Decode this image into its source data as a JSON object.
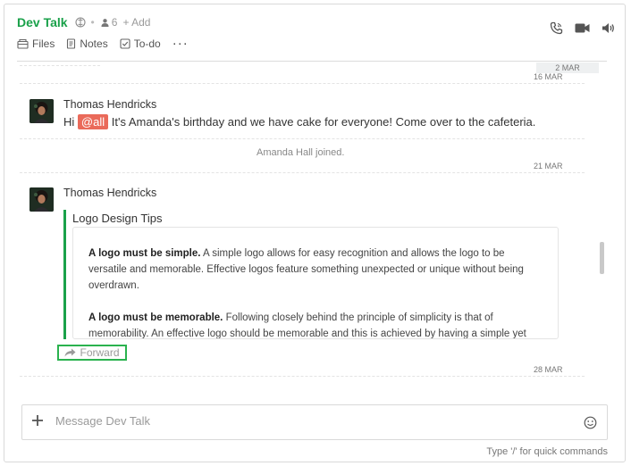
{
  "header": {
    "channel_title": "Dev Talk",
    "member_count": "6",
    "add_label": "+ Add",
    "tabs": [
      {
        "label": "Files",
        "icon": "files-icon"
      },
      {
        "label": "Notes",
        "icon": "notes-icon"
      },
      {
        "label": "To-do",
        "icon": "todo-icon"
      }
    ],
    "more_label": "···",
    "actions": [
      "phone-icon",
      "video-icon",
      "speaker-icon"
    ]
  },
  "timeline": {
    "top_badge": "2 MAR",
    "date_1": "16 MAR",
    "message_1": {
      "sender": "Thomas Hendricks",
      "prefix": "Hi",
      "mention": "@all",
      "text": "It's Amanda's birthday and we have cake for everyone! Come over to the cafeteria."
    },
    "system_message": "Amanda Hall joined.",
    "date_2": "21 MAR",
    "message_2": {
      "sender": "Thomas Hendricks",
      "card_title": "Logo Design Tips",
      "p1_bold": "A logo must be simple.",
      "p1_line1": "A simple logo allows for easy recognition and allows the logo to be",
      "p1_line2": "versatile and memorable. Effective logos feature something unexpected or unique without being",
      "p1_line3": "overdrawn.",
      "p2_bold": "A logo must be memorable.",
      "p2_line1": "Following closely behind the principle of simplicity is that of",
      "p2_line2": "memorability. An effective logo should be memorable and this is achieved by having a simple yet",
      "forward_label": "Forward"
    },
    "date_3": "28 MAR"
  },
  "composer": {
    "placeholder": "Message Dev Talk",
    "hint": "Type '/' for quick commands"
  },
  "colors": {
    "brand": "#1aa14a",
    "mention": "#ea6a5a",
    "forward_highlight": "#2ab24e"
  }
}
